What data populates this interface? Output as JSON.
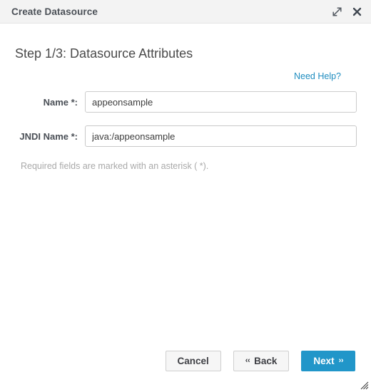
{
  "window": {
    "title": "Create Datasource",
    "actions": [
      {
        "name": "expand-icon",
        "label": "Maximize"
      },
      {
        "name": "close-icon",
        "label": "Close"
      }
    ]
  },
  "main": {
    "step_heading": "Step 1/3: Datasource Attributes",
    "help_link": "Need Help?",
    "note": "Required fields are marked with an asterisk ( *).",
    "fields": [
      {
        "name": "name",
        "label": "Name *:",
        "value": "appeonsample",
        "placeholder": "",
        "focused": false
      },
      {
        "name": "jndi-name",
        "label": "JNDI Name *:",
        "value": "java:/appeonsample",
        "placeholder": "",
        "focused": true
      }
    ]
  },
  "footer": {
    "cancel_label": "Cancel",
    "back_chevron": "‹‹",
    "back_label": "Back",
    "next_label": "Next",
    "next_chevron": "››"
  },
  "colors": {
    "accent": "#2196c9",
    "link": "#1f8dc0",
    "titlebar_bg": "#f3f3f3",
    "text": "#4a4f56",
    "muted": "#a9a9a9",
    "input_border": "#cccccc"
  }
}
